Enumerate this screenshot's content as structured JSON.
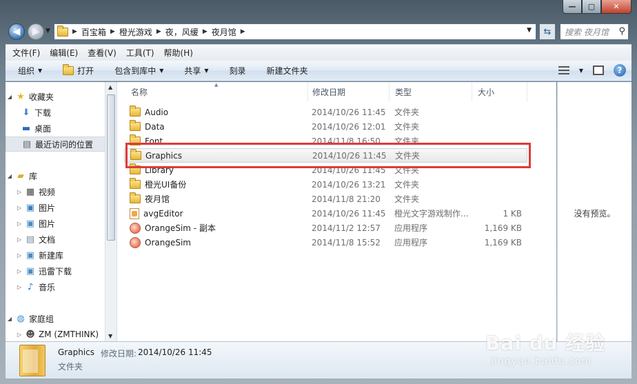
{
  "window": {
    "controls": {
      "minimize": "—",
      "maximize": "▢",
      "close": "✕"
    }
  },
  "nav": {
    "back_icon": "arrow-left-icon",
    "forward_icon": "arrow-right-icon",
    "back_glyph": "◀",
    "forward_glyph": "▶"
  },
  "address": {
    "breadcrumbs": [
      "百宝箱",
      "橙光游戏",
      "夜，风缓",
      "夜月馆"
    ]
  },
  "search": {
    "placeholder": "搜索 夜月馆"
  },
  "menubar": {
    "items": [
      "文件(F)",
      "编辑(E)",
      "查看(V)",
      "工具(T)",
      "帮助(H)"
    ]
  },
  "commandbar": {
    "organize": "组织",
    "open": "打开",
    "include_library": "包含到库中",
    "share": "共享",
    "burn": "刻录",
    "new_folder": "新建文件夹"
  },
  "navpane": {
    "favorites": "收藏夹",
    "favorites_items": [
      "下载",
      "桌面",
      "最近访问的位置"
    ],
    "libraries": "库",
    "library_items": [
      "视频",
      "图片",
      "图片",
      "文档",
      "新建库",
      "迅雷下载",
      "音乐"
    ],
    "homegroup": "家庭组",
    "homegroup_user": "ZM (ZMTHINK)"
  },
  "columns": {
    "name": "名称",
    "date": "修改日期",
    "type": "类型",
    "size": "大小"
  },
  "files": [
    {
      "name": "Audio",
      "date": "2014/10/26 11:45",
      "type": "文件夹",
      "size": "",
      "icon": "folder-icon"
    },
    {
      "name": "Data",
      "date": "2014/10/26 12:01",
      "type": "文件夹",
      "size": "",
      "icon": "folder-icon"
    },
    {
      "name": "Font",
      "date": "2014/11/8 16:50",
      "type": "文件夹",
      "size": "",
      "icon": "folder-icon"
    },
    {
      "name": "Graphics",
      "date": "2014/10/26 11:45",
      "type": "文件夹",
      "size": "",
      "icon": "folder-icon"
    },
    {
      "name": "Library",
      "date": "2014/10/26 11:45",
      "type": "文件夹",
      "size": "",
      "icon": "folder-icon"
    },
    {
      "name": "橙光UI备份",
      "date": "2014/10/26 13:21",
      "type": "文件夹",
      "size": "",
      "icon": "folder-icon"
    },
    {
      "name": "夜月馆",
      "date": "2014/11/8 21:20",
      "type": "文件夹",
      "size": "",
      "icon": "folder-icon"
    },
    {
      "name": "avgEditor",
      "date": "2014/10/26 11:45",
      "type": "橙光文字游戏制作...",
      "size": "1 KB",
      "icon": "document-icon"
    },
    {
      "name": "OrangeSim - 副本",
      "date": "2014/11/2 12:57",
      "type": "应用程序",
      "size": "1,169 KB",
      "icon": "app-icon"
    },
    {
      "name": "OrangeSim",
      "date": "2014/11/8 15:52",
      "type": "应用程序",
      "size": "1,169 KB",
      "icon": "app-icon"
    }
  ],
  "preview": {
    "message": "没有预览。"
  },
  "details": {
    "name": "Graphics",
    "modified_label": "修改日期:",
    "modified": "2014/10/26 11:45",
    "type": "文件夹"
  },
  "watermark": {
    "line1": "Bai du 经验",
    "line2": "jingyan.baidu.com"
  },
  "colors": {
    "highlight": "#e03a3a",
    "accent": "#3b77b6"
  }
}
